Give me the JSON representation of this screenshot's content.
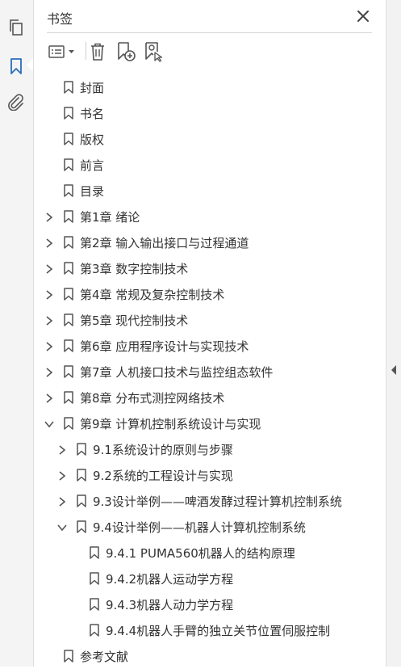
{
  "panel": {
    "title": "书签"
  },
  "bookmarks": [
    {
      "label": "封面",
      "level": 0,
      "expander": "none"
    },
    {
      "label": "书名",
      "level": 0,
      "expander": "none"
    },
    {
      "label": "版权",
      "level": 0,
      "expander": "none"
    },
    {
      "label": "前言",
      "level": 0,
      "expander": "none"
    },
    {
      "label": "目录",
      "level": 0,
      "expander": "none"
    },
    {
      "label": "第1章  绪论",
      "level": 0,
      "expander": "collapsed"
    },
    {
      "label": "第2章  输入输出接口与过程通道",
      "level": 0,
      "expander": "collapsed"
    },
    {
      "label": "第3章  数字控制技术",
      "level": 0,
      "expander": "collapsed"
    },
    {
      "label": "第4章  常规及复杂控制技术",
      "level": 0,
      "expander": "collapsed"
    },
    {
      "label": "第5章  现代控制技术",
      "level": 0,
      "expander": "collapsed"
    },
    {
      "label": "第6章  应用程序设计与实现技术",
      "level": 0,
      "expander": "collapsed"
    },
    {
      "label": "第7章  人机接口技术与监控组态软件",
      "level": 0,
      "expander": "collapsed"
    },
    {
      "label": "第8章  分布式测控网络技术",
      "level": 0,
      "expander": "collapsed"
    },
    {
      "label": "第9章  计算机控制系统设计与实现",
      "level": 0,
      "expander": "expanded"
    },
    {
      "label": "9.1系统设计的原则与步骤",
      "level": 1,
      "expander": "collapsed"
    },
    {
      "label": "9.2系统的工程设计与实现",
      "level": 1,
      "expander": "collapsed"
    },
    {
      "label": "9.3设计举例——啤酒发酵过程计算机控制系统",
      "level": 1,
      "expander": "collapsed"
    },
    {
      "label": "9.4设计举例——机器人计算机控制系统",
      "level": 1,
      "expander": "expanded"
    },
    {
      "label": "9.4.1  PUMA560机器人的结构原理",
      "level": 2,
      "expander": "none"
    },
    {
      "label": "9.4.2机器人运动学方程",
      "level": 2,
      "expander": "none"
    },
    {
      "label": "9.4.3机器人动力学方程",
      "level": 2,
      "expander": "none"
    },
    {
      "label": "9.4.4机器人手臂的独立关节位置伺服控制",
      "level": 2,
      "expander": "none"
    },
    {
      "label": "参考文献",
      "level": 0,
      "expander": "none"
    }
  ],
  "icons": {
    "rail": [
      "pages-icon",
      "bookmark-icon",
      "attachment-icon"
    ],
    "toolbar": [
      "options-icon",
      "delete-icon",
      "new-bookmark-icon",
      "bookmark-search-icon"
    ],
    "close": "close-icon",
    "collapse": "collapse-arrow-icon"
  },
  "colors": {
    "rail_active": "#2a6ebb",
    "text": "#333333",
    "icon": "#555555"
  }
}
